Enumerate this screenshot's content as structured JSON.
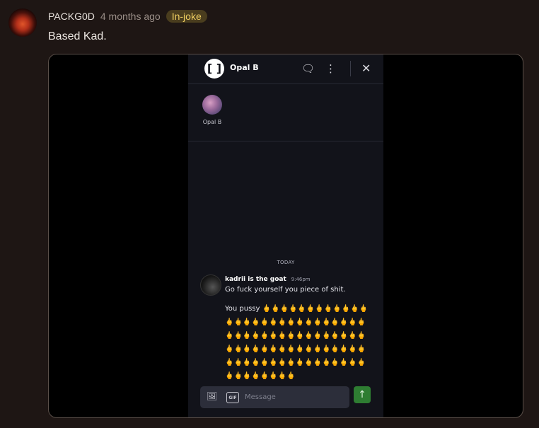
{
  "comment": {
    "username": "PACKG0D",
    "time": "4 months ago",
    "badge": "In-joke",
    "text": "Based Kad."
  },
  "chat": {
    "logo_glyph": "[ ]",
    "title": "Opal B",
    "header_icons": [
      "chat-bubbles-icon",
      "kebab-menu-icon",
      "close-icon"
    ],
    "members": [
      {
        "name": "Opal B"
      }
    ],
    "date_divider": "TODAY",
    "message": {
      "author": "kadrii is the goat",
      "time": "9:46pm",
      "line1": "Go fuck yourself you piece of shit.",
      "line2": "You pussy 🖕🖕🖕🖕🖕🖕🖕🖕🖕🖕🖕🖕🖕🖕🖕🖕🖕🖕🖕🖕🖕🖕🖕🖕🖕🖕🖕🖕🖕🖕🖕🖕🖕🖕🖕🖕🖕🖕🖕🖕🖕🖕🖕🖕🖕🖕🖕🖕🖕🖕🖕🖕🖕🖕🖕🖕🖕🖕🖕🖕🖕🖕🖕🖕🖕🖕🖕🖕🖕🖕🖕🖕🖕🖕🖕🖕🖕🖕🖕🖕🖕🖕🖕🖕"
    },
    "composer": {
      "placeholder": "Message",
      "gif_label": "GIF"
    }
  }
}
